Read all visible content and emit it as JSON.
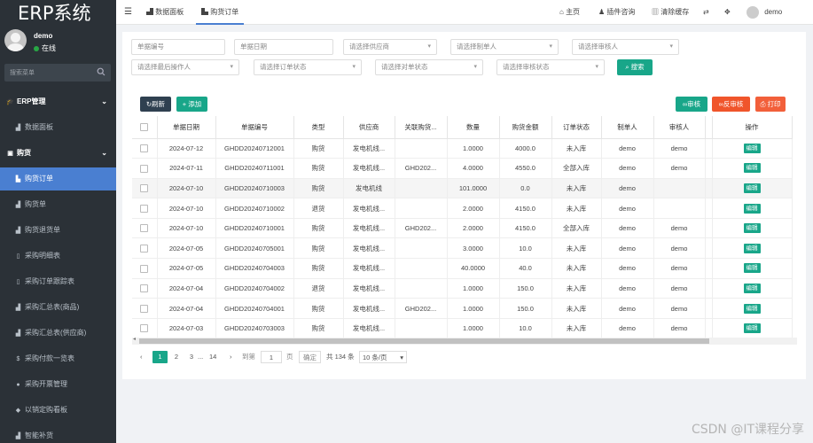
{
  "app": {
    "title": "ERP系统"
  },
  "user": {
    "name": "demo",
    "status": "在线"
  },
  "sidebar": {
    "search_placeholder": "搜索菜单",
    "items": [
      {
        "label": "ERP管理",
        "icon": "graduation-cap-icon"
      },
      {
        "label": "数据面板",
        "icon": "area-chart-icon"
      },
      {
        "label": "购货",
        "icon": "cart-icon"
      },
      {
        "label": "购货订单",
        "icon": "bar-chart-icon"
      },
      {
        "label": "购货单",
        "icon": "area-chart-icon"
      },
      {
        "label": "购货退货单",
        "icon": "area-chart-icon"
      },
      {
        "label": "采购明细表",
        "icon": "document-icon"
      },
      {
        "label": "采购订单跟踪表",
        "icon": "document-icon"
      },
      {
        "label": "采购汇总表(商品)",
        "icon": "area-chart-icon"
      },
      {
        "label": "采购汇总表(供应商)",
        "icon": "area-chart-icon"
      },
      {
        "label": "采购付款一览表",
        "icon": "dollar-icon"
      },
      {
        "label": "采购开票管理",
        "icon": "gear-icon"
      },
      {
        "label": "以销定购看板",
        "icon": "cube-icon"
      },
      {
        "label": "智能补货",
        "icon": "chart-icon"
      }
    ]
  },
  "topbar": {
    "menu_icon": "hamburger-icon",
    "tabs": [
      {
        "label": "数据面板"
      },
      {
        "label": "购货订单"
      }
    ],
    "actions": [
      {
        "label": "主页"
      },
      {
        "label": "插件咨询"
      },
      {
        "label": "清除缓存"
      }
    ],
    "username": "demo"
  },
  "filters": {
    "row1": [
      "单据编号",
      "单据日期",
      "请选择供应商",
      "请选择制单人",
      "请选择审核人"
    ],
    "row2": [
      "请选择最后操作人",
      "请选择订单状态",
      "请选择对单状态",
      "请选择审核状态"
    ],
    "search_label": "搜索"
  },
  "toolbar": {
    "refresh_label": "刷新",
    "add_label": "添加",
    "audit_label": "审核",
    "unaudit_label": "反审核",
    "print_label": "打印"
  },
  "table": {
    "headers": [
      "单据日期",
      "单据编号",
      "类型",
      "供应商",
      "关联购货...",
      "数量",
      "购货金额",
      "订单状态",
      "制单人",
      "审核人",
      "",
      "操作"
    ],
    "edit_label": "编辑",
    "rows": [
      [
        "2024-07-12",
        "GHDD20240712001",
        "购货",
        "发电机线...",
        "",
        "1.0000",
        "4000.0",
        "未入库",
        "demo",
        "demo"
      ],
      [
        "2024-07-11",
        "GHDD20240711001",
        "购货",
        "发电机线...",
        "GHD202...",
        "4.0000",
        "4550.0",
        "全部入库",
        "demo",
        "demo"
      ],
      [
        "2024-07-10",
        "GHDD20240710003",
        "购货",
        "发电机线",
        "",
        "101.0000",
        "0.0",
        "未入库",
        "demo",
        ""
      ],
      [
        "2024-07-10",
        "GHDD20240710002",
        "退货",
        "发电机线...",
        "",
        "2.0000",
        "4150.0",
        "未入库",
        "demo",
        ""
      ],
      [
        "2024-07-10",
        "GHDD20240710001",
        "购货",
        "发电机线...",
        "GHD202...",
        "2.0000",
        "4150.0",
        "全部入库",
        "demo",
        "demo"
      ],
      [
        "2024-07-05",
        "GHDD20240705001",
        "购货",
        "发电机线...",
        "",
        "3.0000",
        "10.0",
        "未入库",
        "demo",
        "demo"
      ],
      [
        "2024-07-05",
        "GHDD20240704003",
        "购货",
        "发电机线...",
        "",
        "40.0000",
        "40.0",
        "未入库",
        "demo",
        "demo"
      ],
      [
        "2024-07-04",
        "GHDD20240704002",
        "退货",
        "发电机线...",
        "",
        "1.0000",
        "150.0",
        "未入库",
        "demo",
        "demo"
      ],
      [
        "2024-07-04",
        "GHDD20240704001",
        "购货",
        "发电机线...",
        "GHD202...",
        "1.0000",
        "150.0",
        "未入库",
        "demo",
        "demo"
      ],
      [
        "2024-07-03",
        "GHDD20240703003",
        "购货",
        "发电机线...",
        "",
        "1.0000",
        "10.0",
        "未入库",
        "demo",
        "demo"
      ]
    ]
  },
  "pagination": {
    "prev": "‹",
    "pages": [
      "1",
      "2",
      "3",
      "...",
      "14"
    ],
    "next": "›",
    "goto_label": "到第",
    "goto_value": "1",
    "page_unit": "页",
    "confirm_label": "确定",
    "total_label": "共 134 条",
    "page_size": "10 条/页"
  },
  "watermark": "CSDN @IT课程分享"
}
